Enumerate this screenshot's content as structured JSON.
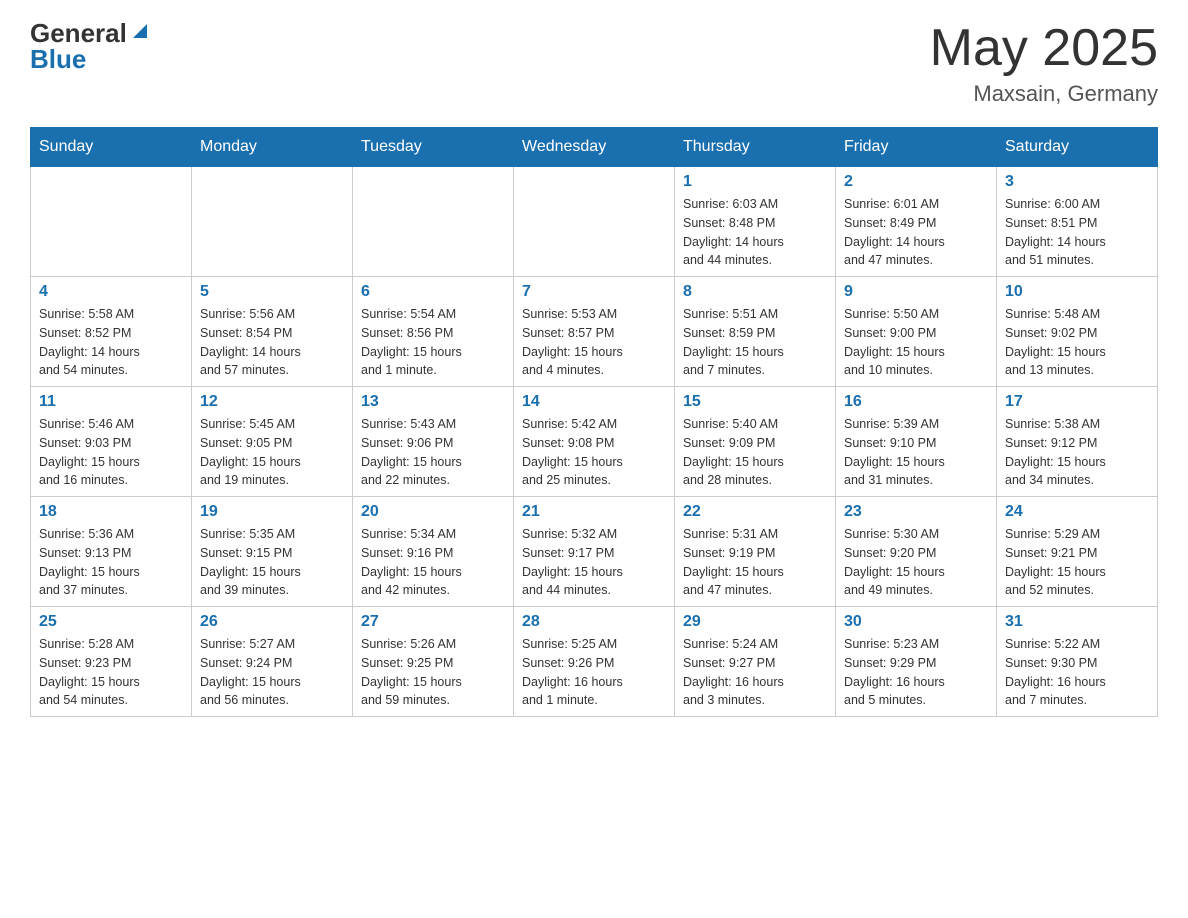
{
  "header": {
    "logo_general": "General",
    "logo_blue": "Blue",
    "month_year": "May 2025",
    "location": "Maxsain, Germany"
  },
  "days_of_week": [
    "Sunday",
    "Monday",
    "Tuesday",
    "Wednesday",
    "Thursday",
    "Friday",
    "Saturday"
  ],
  "weeks": [
    [
      {
        "day": "",
        "info": ""
      },
      {
        "day": "",
        "info": ""
      },
      {
        "day": "",
        "info": ""
      },
      {
        "day": "",
        "info": ""
      },
      {
        "day": "1",
        "info": "Sunrise: 6:03 AM\nSunset: 8:48 PM\nDaylight: 14 hours\nand 44 minutes."
      },
      {
        "day": "2",
        "info": "Sunrise: 6:01 AM\nSunset: 8:49 PM\nDaylight: 14 hours\nand 47 minutes."
      },
      {
        "day": "3",
        "info": "Sunrise: 6:00 AM\nSunset: 8:51 PM\nDaylight: 14 hours\nand 51 minutes."
      }
    ],
    [
      {
        "day": "4",
        "info": "Sunrise: 5:58 AM\nSunset: 8:52 PM\nDaylight: 14 hours\nand 54 minutes."
      },
      {
        "day": "5",
        "info": "Sunrise: 5:56 AM\nSunset: 8:54 PM\nDaylight: 14 hours\nand 57 minutes."
      },
      {
        "day": "6",
        "info": "Sunrise: 5:54 AM\nSunset: 8:56 PM\nDaylight: 15 hours\nand 1 minute."
      },
      {
        "day": "7",
        "info": "Sunrise: 5:53 AM\nSunset: 8:57 PM\nDaylight: 15 hours\nand 4 minutes."
      },
      {
        "day": "8",
        "info": "Sunrise: 5:51 AM\nSunset: 8:59 PM\nDaylight: 15 hours\nand 7 minutes."
      },
      {
        "day": "9",
        "info": "Sunrise: 5:50 AM\nSunset: 9:00 PM\nDaylight: 15 hours\nand 10 minutes."
      },
      {
        "day": "10",
        "info": "Sunrise: 5:48 AM\nSunset: 9:02 PM\nDaylight: 15 hours\nand 13 minutes."
      }
    ],
    [
      {
        "day": "11",
        "info": "Sunrise: 5:46 AM\nSunset: 9:03 PM\nDaylight: 15 hours\nand 16 minutes."
      },
      {
        "day": "12",
        "info": "Sunrise: 5:45 AM\nSunset: 9:05 PM\nDaylight: 15 hours\nand 19 minutes."
      },
      {
        "day": "13",
        "info": "Sunrise: 5:43 AM\nSunset: 9:06 PM\nDaylight: 15 hours\nand 22 minutes."
      },
      {
        "day": "14",
        "info": "Sunrise: 5:42 AM\nSunset: 9:08 PM\nDaylight: 15 hours\nand 25 minutes."
      },
      {
        "day": "15",
        "info": "Sunrise: 5:40 AM\nSunset: 9:09 PM\nDaylight: 15 hours\nand 28 minutes."
      },
      {
        "day": "16",
        "info": "Sunrise: 5:39 AM\nSunset: 9:10 PM\nDaylight: 15 hours\nand 31 minutes."
      },
      {
        "day": "17",
        "info": "Sunrise: 5:38 AM\nSunset: 9:12 PM\nDaylight: 15 hours\nand 34 minutes."
      }
    ],
    [
      {
        "day": "18",
        "info": "Sunrise: 5:36 AM\nSunset: 9:13 PM\nDaylight: 15 hours\nand 37 minutes."
      },
      {
        "day": "19",
        "info": "Sunrise: 5:35 AM\nSunset: 9:15 PM\nDaylight: 15 hours\nand 39 minutes."
      },
      {
        "day": "20",
        "info": "Sunrise: 5:34 AM\nSunset: 9:16 PM\nDaylight: 15 hours\nand 42 minutes."
      },
      {
        "day": "21",
        "info": "Sunrise: 5:32 AM\nSunset: 9:17 PM\nDaylight: 15 hours\nand 44 minutes."
      },
      {
        "day": "22",
        "info": "Sunrise: 5:31 AM\nSunset: 9:19 PM\nDaylight: 15 hours\nand 47 minutes."
      },
      {
        "day": "23",
        "info": "Sunrise: 5:30 AM\nSunset: 9:20 PM\nDaylight: 15 hours\nand 49 minutes."
      },
      {
        "day": "24",
        "info": "Sunrise: 5:29 AM\nSunset: 9:21 PM\nDaylight: 15 hours\nand 52 minutes."
      }
    ],
    [
      {
        "day": "25",
        "info": "Sunrise: 5:28 AM\nSunset: 9:23 PM\nDaylight: 15 hours\nand 54 minutes."
      },
      {
        "day": "26",
        "info": "Sunrise: 5:27 AM\nSunset: 9:24 PM\nDaylight: 15 hours\nand 56 minutes."
      },
      {
        "day": "27",
        "info": "Sunrise: 5:26 AM\nSunset: 9:25 PM\nDaylight: 15 hours\nand 59 minutes."
      },
      {
        "day": "28",
        "info": "Sunrise: 5:25 AM\nSunset: 9:26 PM\nDaylight: 16 hours\nand 1 minute."
      },
      {
        "day": "29",
        "info": "Sunrise: 5:24 AM\nSunset: 9:27 PM\nDaylight: 16 hours\nand 3 minutes."
      },
      {
        "day": "30",
        "info": "Sunrise: 5:23 AM\nSunset: 9:29 PM\nDaylight: 16 hours\nand 5 minutes."
      },
      {
        "day": "31",
        "info": "Sunrise: 5:22 AM\nSunset: 9:30 PM\nDaylight: 16 hours\nand 7 minutes."
      }
    ]
  ]
}
